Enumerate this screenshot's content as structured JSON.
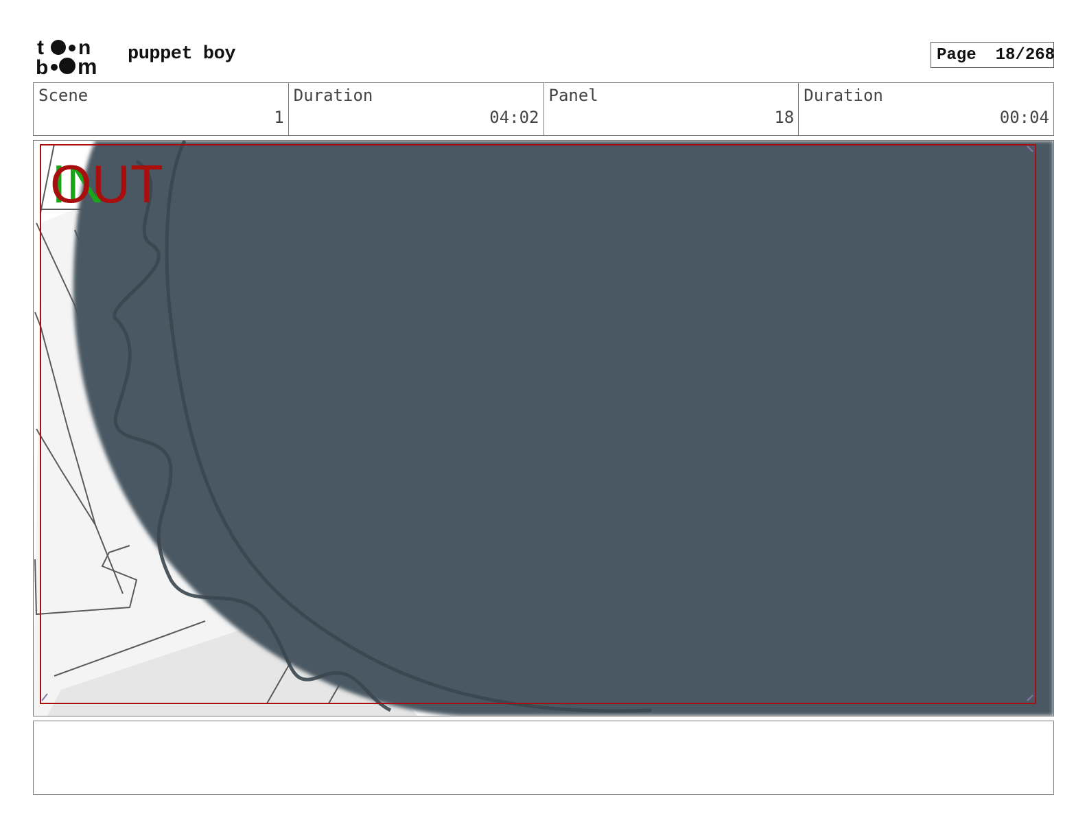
{
  "header": {
    "logo_text": "toon boom",
    "project_title": "puppet boy",
    "page_label": "Page",
    "page_value": "18/268"
  },
  "info": {
    "scene_label": "Scene",
    "scene_value": "1",
    "scene_duration_label": "Duration",
    "scene_duration_value": "04:02",
    "panel_label": "Panel",
    "panel_value": "18",
    "panel_duration_label": "Duration",
    "panel_duration_value": "00:04"
  },
  "panel": {
    "in_marker": "IN",
    "out_marker": "OUT",
    "colors": {
      "shape_fill": "#485863",
      "safe_frame": "#a80e0e",
      "in_marker": "#1aa51a",
      "out_marker": "#a80e0e"
    }
  },
  "notes": {
    "text": ""
  }
}
